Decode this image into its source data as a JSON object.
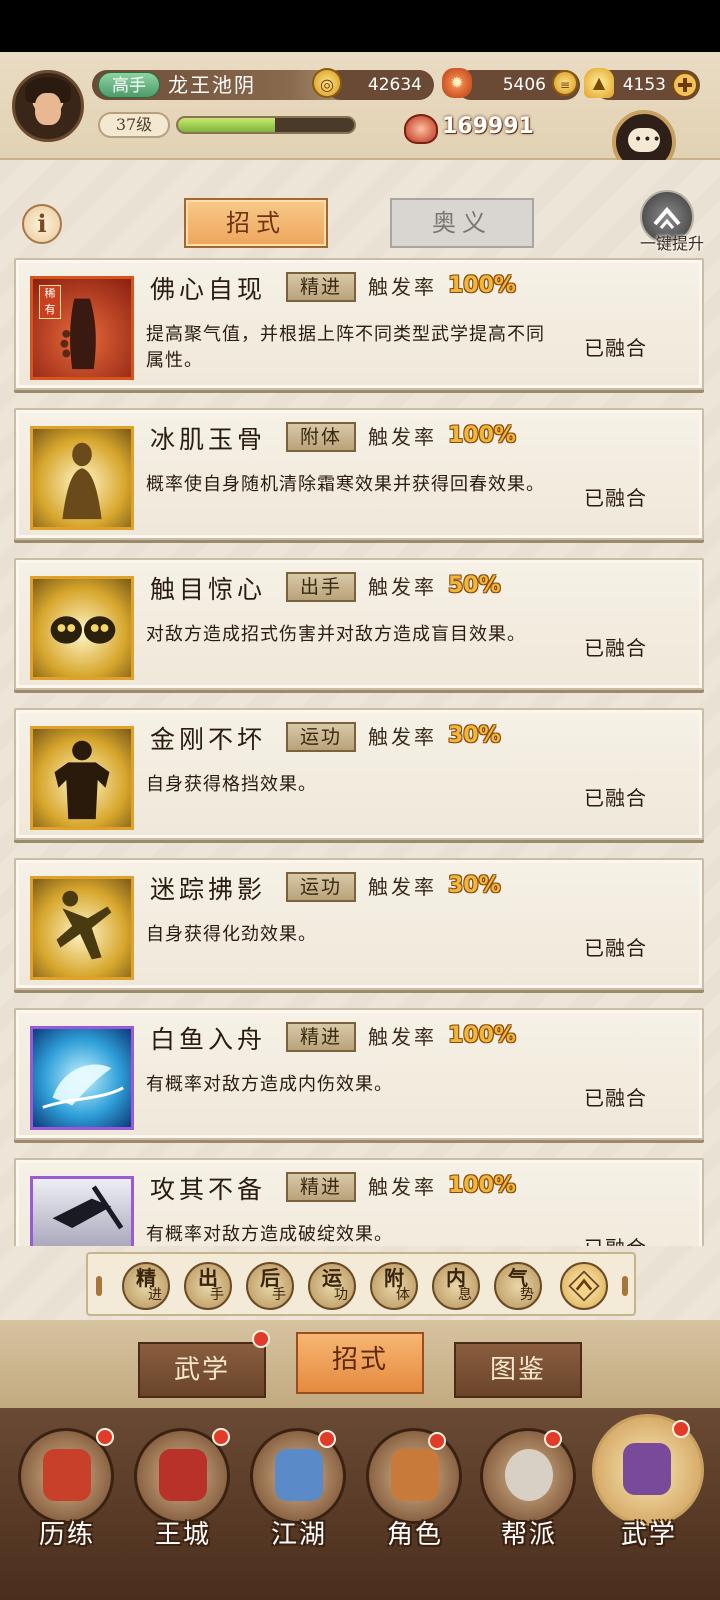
{
  "header": {
    "rank": "高手",
    "player_name": "龙王池阴",
    "level": "37级",
    "exp_fraction": 0.55,
    "coins": "42634",
    "leaves": "5406",
    "ingots": "4153",
    "power": "169991"
  },
  "tabs": {
    "active": "招式",
    "inactive": "奥义"
  },
  "upgrade_label": "一键提升",
  "skills": [
    {
      "name": "佛心自现",
      "type": "精进",
      "rate_label": "触发率",
      "rate": "100%",
      "desc": "提高聚气值，并根据上阵不同类型武学提高不同属性。",
      "status": "已融合",
      "rare": "稀有"
    },
    {
      "name": "冰肌玉骨",
      "type": "附体",
      "rate_label": "触发率",
      "rate": "100%",
      "desc": "概率使自身随机清除霜寒效果并获得回春效果。",
      "status": "已融合"
    },
    {
      "name": "触目惊心",
      "type": "出手",
      "rate_label": "触发率",
      "rate": "50%",
      "desc": "对敌方造成招式伤害并对敌方造成盲目效果。",
      "status": "已融合"
    },
    {
      "name": "金刚不坏",
      "type": "运功",
      "rate_label": "触发率",
      "rate": "30%",
      "desc": "自身获得格挡效果。",
      "status": "已融合"
    },
    {
      "name": "迷踪拂影",
      "type": "运功",
      "rate_label": "触发率",
      "rate": "30%",
      "desc": "自身获得化劲效果。",
      "status": "已融合"
    },
    {
      "name": "白鱼入舟",
      "type": "精进",
      "rate_label": "触发率",
      "rate": "100%",
      "desc": "有概率对敌方造成内伤效果。",
      "status": "已融合"
    },
    {
      "name": "攻其不备",
      "type": "精进",
      "rate_label": "触发率",
      "rate": "100%",
      "desc": "有概率对敌方造成破绽效果。",
      "status": "已融合"
    }
  ],
  "filters": [
    {
      "big": "精",
      "small": "进"
    },
    {
      "big": "出",
      "small": "手"
    },
    {
      "big": "后",
      "small": "手"
    },
    {
      "big": "运",
      "small": "功"
    },
    {
      "big": "附",
      "small": "体"
    },
    {
      "big": "内",
      "small": "息"
    },
    {
      "big": "气",
      "small": "势"
    }
  ],
  "subtabs": {
    "left": "武学",
    "center": "招式",
    "right": "图鉴"
  },
  "nav": [
    "历练",
    "王城",
    "江湖",
    "角色",
    "帮派",
    "武学"
  ],
  "colors": {
    "accent": "#eda55c",
    "rate": "#f2b73a",
    "badge_dot": "#e23b2a"
  }
}
